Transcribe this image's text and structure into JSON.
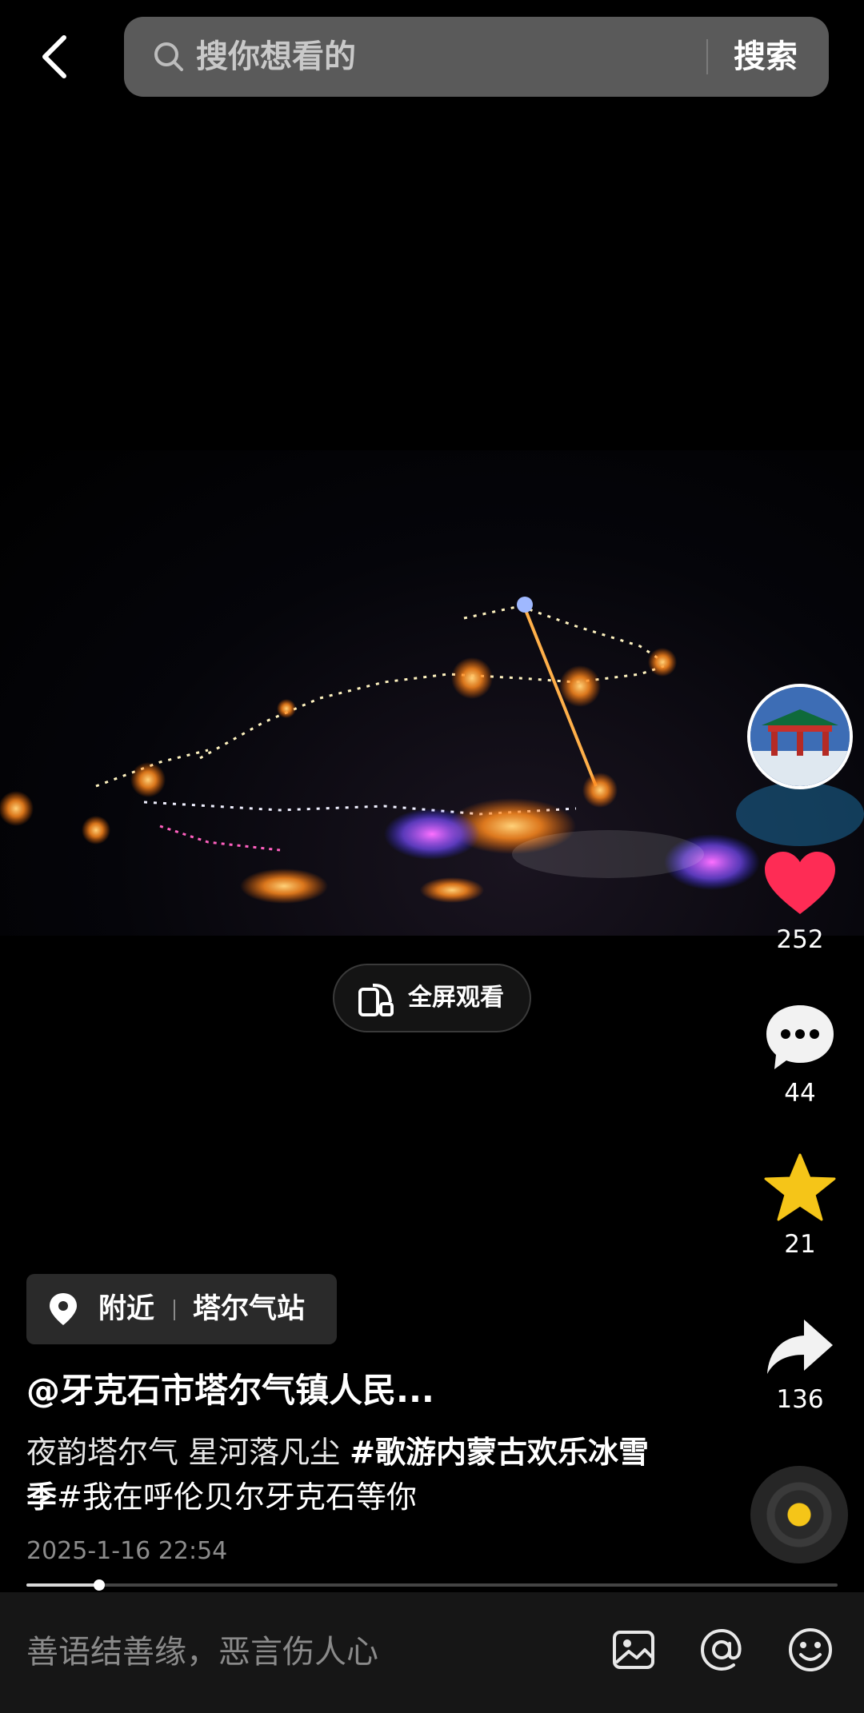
{
  "header": {
    "search_placeholder": "搜你想看的",
    "search_button": "搜索"
  },
  "video": {
    "fullscreen_label": "全屏观看"
  },
  "actions": {
    "like_count": "252",
    "comment_count": "44",
    "favorite_count": "21",
    "share_count": "136"
  },
  "post": {
    "location_prefix": "附近",
    "location_name": "塔尔气站",
    "author": "@牙克石市塔尔气镇人民...",
    "desc_text_1": "夜韵塔尔气 星河落凡尘 ",
    "desc_tag_1": "#歌游内蒙古欢乐冰雪季",
    "desc_tag_2": "#我在呼伦贝尔牙克石等你",
    "timestamp": "2025-1-16 22:54",
    "progress": 0.09
  },
  "comment_bar": {
    "placeholder": "善语结善缘，恶言伤人心"
  },
  "colors": {
    "like": "#fe2c55",
    "favorite": "#f5c518",
    "background": "#000000"
  }
}
